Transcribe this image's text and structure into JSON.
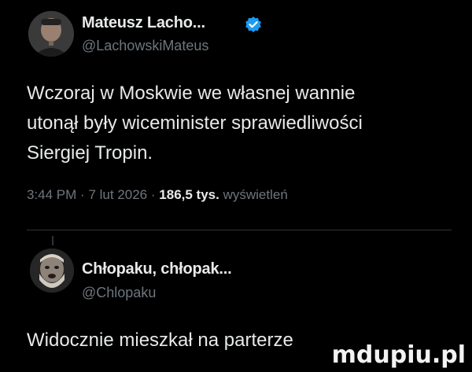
{
  "tweet1": {
    "author_name": "Mateusz Lacho...",
    "handle": "@LachowskiMateus",
    "verified_icon": "verified-badge-icon",
    "text_lines": [
      "Wczoraj w Moskwie we własnej wannie",
      "utonął były wiceminister sprawiedliwości",
      "Siergiej Tropin."
    ],
    "time": "3:44 PM",
    "date": "7 lut 2026",
    "views_count": "186,5 tys.",
    "views_label": "wyświetleń",
    "separator": "·"
  },
  "tweet2": {
    "author_name": "Chłopaku, chłopak...",
    "handle": "@Chlopaku",
    "text": "Widocznie mieszkał na parterze"
  },
  "watermark": "mdupiu.pl",
  "colors": {
    "background": "#000000",
    "text": "#e7e9ea",
    "muted": "#6e767d",
    "verified": "#1d9bf0"
  }
}
